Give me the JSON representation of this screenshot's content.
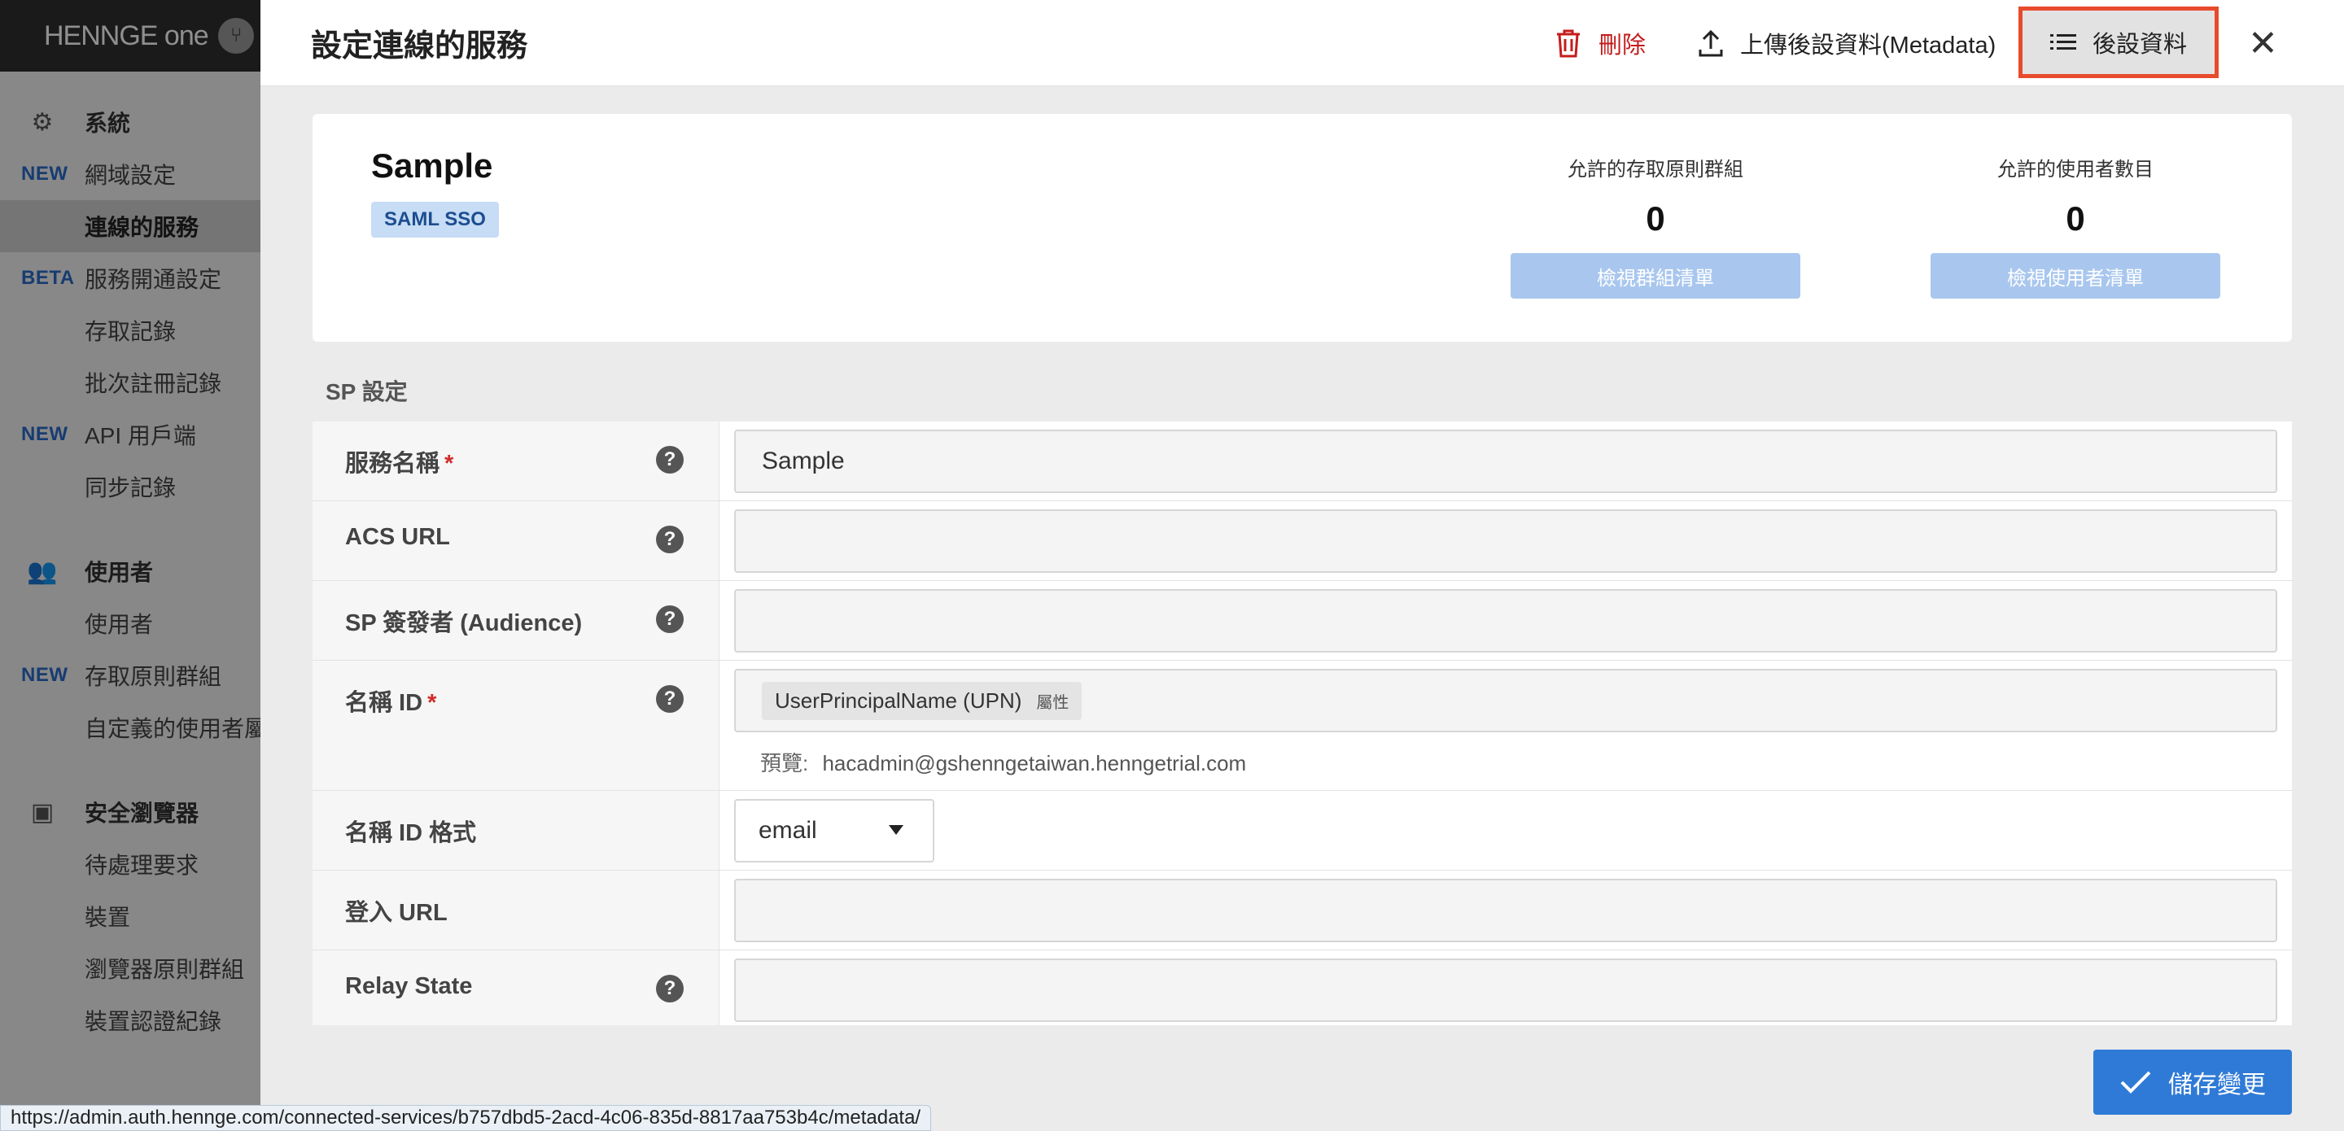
{
  "sidebar": {
    "brand": "HENNGE one",
    "sections": [
      {
        "heading": "系統",
        "icon": "gear-icon",
        "items": [
          {
            "tag": "NEW",
            "label": "網域設定",
            "active": false
          },
          {
            "tag": "",
            "label": "連線的服務",
            "active": true
          },
          {
            "tag": "BETA",
            "label": "服務開通設定",
            "active": false
          },
          {
            "tag": "",
            "label": "存取記錄",
            "active": false
          },
          {
            "tag": "",
            "label": "批次註冊記錄",
            "active": false
          },
          {
            "tag": "NEW",
            "label": "API 用戶端",
            "active": false
          },
          {
            "tag": "",
            "label": "同步記錄",
            "active": false
          }
        ]
      },
      {
        "heading": "使用者",
        "icon": "users-icon",
        "items": [
          {
            "tag": "",
            "label": "使用者",
            "active": false
          },
          {
            "tag": "NEW",
            "label": "存取原則群組",
            "active": false
          },
          {
            "tag": "",
            "label": "自定義的使用者屬",
            "active": false
          }
        ]
      },
      {
        "heading": "安全瀏覽器",
        "icon": "browser-icon",
        "items": [
          {
            "tag": "",
            "label": "待處理要求",
            "active": false
          },
          {
            "tag": "",
            "label": "裝置",
            "active": false
          },
          {
            "tag": "",
            "label": "瀏覽器原則群組",
            "active": false
          },
          {
            "tag": "",
            "label": "裝置認證紀錄",
            "active": false
          }
        ]
      }
    ]
  },
  "topbar": {
    "title": "設定連線的服務",
    "delete_label": "刪除",
    "upload_label": "上傳後設資料(Metadata)",
    "metadata_label": "後設資料"
  },
  "card": {
    "service_name": "Sample",
    "badge": "SAML SSO",
    "stats": [
      {
        "label": "允許的存取原則群組",
        "value": "0",
        "button": "檢視群組清單"
      },
      {
        "label": "允許的使用者數目",
        "value": "0",
        "button": "檢視使用者清單"
      }
    ]
  },
  "sp_section_title": "SP 設定",
  "form": {
    "service_name": {
      "label": "服務名稱",
      "required": "*",
      "value": "Sample"
    },
    "acs_url": {
      "label": "ACS URL",
      "value": ""
    },
    "audience": {
      "label": "SP 簽發者 (Audience)",
      "value": ""
    },
    "name_id": {
      "label": "名稱 ID",
      "required": "*",
      "chip": "UserPrincipalName (UPN)",
      "chip_sub": "屬性",
      "preview_label": "預覽:",
      "preview_value": "hacadmin@gshenngetaiwan.henngetrial.com"
    },
    "name_id_format": {
      "label": "名稱 ID 格式",
      "value": "email"
    },
    "login_url": {
      "label": "登入 URL",
      "value": ""
    },
    "relay_state": {
      "label": "Relay State",
      "value": ""
    }
  },
  "save_label": "儲存變更",
  "status_url": "https://admin.auth.hennge.com/connected-services/b757dbd5-2acd-4c06-835d-8817aa753b4c/metadata/",
  "colors": {
    "accent": "#2f7ad6",
    "danger": "#c41c1c",
    "highlight_border": "#e84b2c",
    "badge_bg": "#c7dcf5"
  }
}
